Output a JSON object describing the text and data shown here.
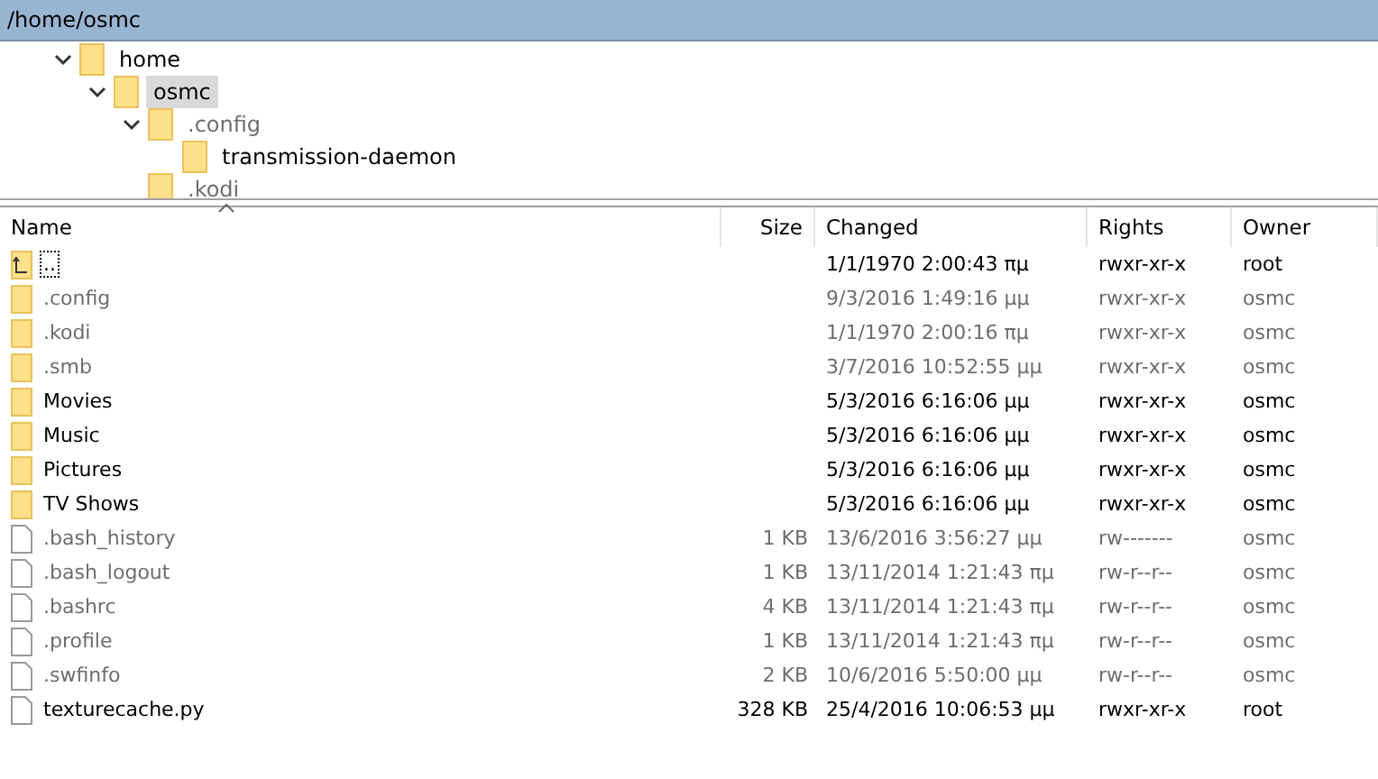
{
  "path_bar": {
    "text": "/home/osmc"
  },
  "tree": [
    {
      "label": "home",
      "expanded": true,
      "selected": false,
      "hidden": false,
      "children": [
        {
          "label": "osmc",
          "expanded": true,
          "selected": true,
          "hidden": false,
          "children": [
            {
              "label": ".config",
              "expanded": true,
              "selected": false,
              "hidden": true,
              "children": [
                {
                  "label": "transmission-daemon",
                  "selected": false,
                  "hidden": false
                }
              ]
            },
            {
              "label": ".kodi",
              "selected": false,
              "hidden": true
            }
          ]
        }
      ]
    }
  ],
  "table": {
    "columns": [
      {
        "label": "Name"
      },
      {
        "label": "Size"
      },
      {
        "label": "Changed"
      },
      {
        "label": "Rights"
      },
      {
        "label": "Owner"
      }
    ],
    "rows": [
      {
        "kind": "parent",
        "name": "..",
        "size": "",
        "changed": "1/1/1970 2:00:43 πμ",
        "rights": "rwxr-xr-x",
        "owner": "root",
        "hidden": false,
        "focused": true
      },
      {
        "kind": "folder",
        "name": ".config",
        "size": "",
        "changed": "9/3/2016 1:49:16 μμ",
        "rights": "rwxr-xr-x",
        "owner": "osmc",
        "hidden": true,
        "focused": false
      },
      {
        "kind": "folder",
        "name": ".kodi",
        "size": "",
        "changed": "1/1/1970 2:00:16 πμ",
        "rights": "rwxr-xr-x",
        "owner": "osmc",
        "hidden": true,
        "focused": false
      },
      {
        "kind": "folder",
        "name": ".smb",
        "size": "",
        "changed": "3/7/2016 10:52:55 μμ",
        "rights": "rwxr-xr-x",
        "owner": "osmc",
        "hidden": true,
        "focused": false
      },
      {
        "kind": "folder",
        "name": "Movies",
        "size": "",
        "changed": "5/3/2016 6:16:06 μμ",
        "rights": "rwxr-xr-x",
        "owner": "osmc",
        "hidden": false,
        "focused": false
      },
      {
        "kind": "folder",
        "name": "Music",
        "size": "",
        "changed": "5/3/2016 6:16:06 μμ",
        "rights": "rwxr-xr-x",
        "owner": "osmc",
        "hidden": false,
        "focused": false
      },
      {
        "kind": "folder",
        "name": "Pictures",
        "size": "",
        "changed": "5/3/2016 6:16:06 μμ",
        "rights": "rwxr-xr-x",
        "owner": "osmc",
        "hidden": false,
        "focused": false
      },
      {
        "kind": "folder",
        "name": "TV Shows",
        "size": "",
        "changed": "5/3/2016 6:16:06 μμ",
        "rights": "rwxr-xr-x",
        "owner": "osmc",
        "hidden": false,
        "focused": false
      },
      {
        "kind": "file",
        "name": ".bash_history",
        "size": "1 KB",
        "changed": "13/6/2016 3:56:27 μμ",
        "rights": "rw-------",
        "owner": "osmc",
        "hidden": true,
        "focused": false
      },
      {
        "kind": "file",
        "name": ".bash_logout",
        "size": "1 KB",
        "changed": "13/11/2014 1:21:43 πμ",
        "rights": "rw-r--r--",
        "owner": "osmc",
        "hidden": true,
        "focused": false
      },
      {
        "kind": "file",
        "name": ".bashrc",
        "size": "4 KB",
        "changed": "13/11/2014 1:21:43 πμ",
        "rights": "rw-r--r--",
        "owner": "osmc",
        "hidden": true,
        "focused": false
      },
      {
        "kind": "file",
        "name": ".profile",
        "size": "1 KB",
        "changed": "13/11/2014 1:21:43 πμ",
        "rights": "rw-r--r--",
        "owner": "osmc",
        "hidden": true,
        "focused": false
      },
      {
        "kind": "file",
        "name": ".swfinfo",
        "size": "2 KB",
        "changed": "10/6/2016 5:50:00 μμ",
        "rights": "rw-r--r--",
        "owner": "osmc",
        "hidden": true,
        "focused": false
      },
      {
        "kind": "file",
        "name": "texturecache.py",
        "size": "328 KB",
        "changed": "25/4/2016 10:06:53 μμ",
        "rights": "rwxr-xr-x",
        "owner": "root",
        "hidden": false,
        "focused": false
      }
    ]
  }
}
